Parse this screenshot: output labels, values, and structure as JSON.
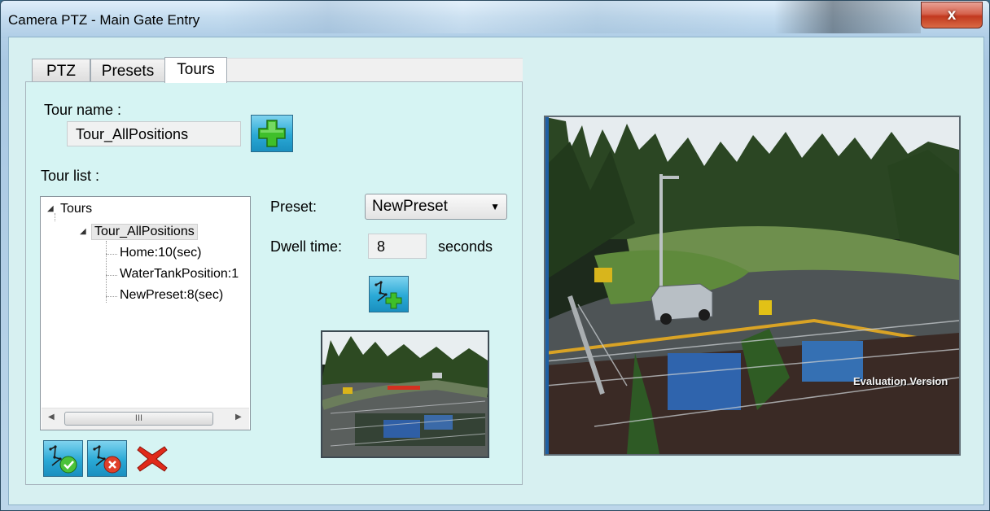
{
  "window": {
    "title": "Camera PTZ - Main Gate Entry",
    "close_label": "x"
  },
  "tabs": [
    {
      "label": "PTZ",
      "active": false
    },
    {
      "label": "Presets",
      "active": false
    },
    {
      "label": "Tours",
      "active": true
    }
  ],
  "tour": {
    "name_label": "Tour name :",
    "name_value": "Tour_AllPositions",
    "list_label": "Tour list :",
    "tree": {
      "root": "Tours",
      "child": "Tour_AllPositions",
      "items": [
        "Home:10(sec)",
        "WaterTankPosition:1",
        "NewPreset:8(sec)"
      ]
    },
    "scroll_thumb": "III"
  },
  "preset": {
    "label": "Preset:",
    "selected": "NewPreset"
  },
  "dwell": {
    "label": "Dwell time:",
    "value": "8",
    "unit": "seconds"
  },
  "video": {
    "watermark": "Evaluation Version"
  },
  "icons": {
    "add_tour": "plus-icon",
    "add_step": "tour-add-icon",
    "apply": "tour-apply-icon",
    "remove": "tour-remove-icon",
    "delete": "delete-x-icon"
  },
  "colors": {
    "client_bg": "#d7f0f1",
    "accent_blue": "#2aa9d6",
    "plus_green": "#3fbf2a",
    "delete_red": "#e02a1a"
  }
}
